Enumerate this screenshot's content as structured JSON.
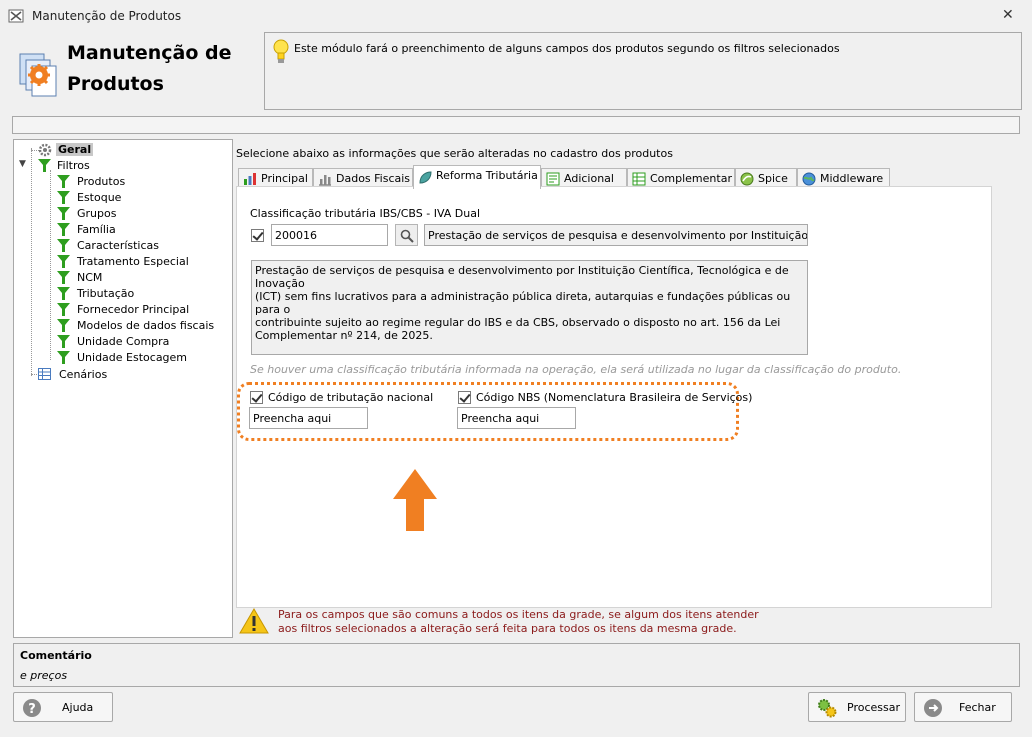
{
  "window": {
    "title": "Manutenção de Produtos",
    "close_glyph": "✕"
  },
  "header": {
    "title_line1": "Manutenção de",
    "title_line2": "Produtos",
    "info": "Este módulo fará o preenchimento de alguns campos dos produtos segundo os filtros selecionados"
  },
  "tree": {
    "root": "Geral",
    "filtros": "Filtros",
    "items": [
      "Produtos",
      "Estoque",
      "Grupos",
      "Família",
      "Características",
      "Tratamento Especial",
      "NCM",
      "Tributação",
      "Fornecedor Principal",
      "Modelos de dados fiscais",
      "Unidade Compra",
      "Unidade Estocagem"
    ],
    "cenarios": "Cenários"
  },
  "main": {
    "instruction": "Selecione abaixo as informações que serão alteradas no cadastro dos produtos",
    "tabs": [
      "Principal",
      "Dados Fiscais",
      "Reforma Tributária",
      "Adicional",
      "Complementar",
      "Spice",
      "Middleware"
    ],
    "active_tab": "Reforma Tributária",
    "section_label": "Classificação tributária IBS/CBS - IVA Dual",
    "code_value": "200016",
    "description_value": "Prestação de serviços de pesquisa e desenvolvimento por Instituição Cient",
    "memo_lines": [
      "Prestação de serviços de pesquisa e desenvolvimento por Instituição Científica, Tecnológica e de Inovação",
      "(ICT) sem fins lucrativos para a administração pública direta, autarquias e fundações públicas ou para o",
      "contribuinte sujeito ao regime regular do IBS e da CBS, observado o disposto no art. 156 da Lei",
      "Complementar nº 214, de 2025."
    ],
    "hint": "Se houver uma classificação tributária informada na operação, ela será utilizada no lugar da classificação do produto.",
    "cod_trib_label": "Código de tributação nacional",
    "cod_trib_value": "Preencha aqui",
    "nbs_label": "Código NBS (Nomenclatura Brasileira de Serviços)",
    "nbs_value": "Preencha aqui",
    "warning_line1": "Para os campos que são comuns a todos os itens da grade, se algum dos itens atender",
    "warning_line2": "aos filtros selecionados a alteração será feita para todos os itens da mesma grade."
  },
  "comment": {
    "title": "Comentário",
    "text": "e preços"
  },
  "buttons": {
    "help": "Ajuda",
    "process": "Processar",
    "close": "Fechar"
  },
  "colors": {
    "accent_orange": "#f07f22",
    "funnel_green": "#2e9e1f",
    "warning_text": "#8b1a1a"
  }
}
